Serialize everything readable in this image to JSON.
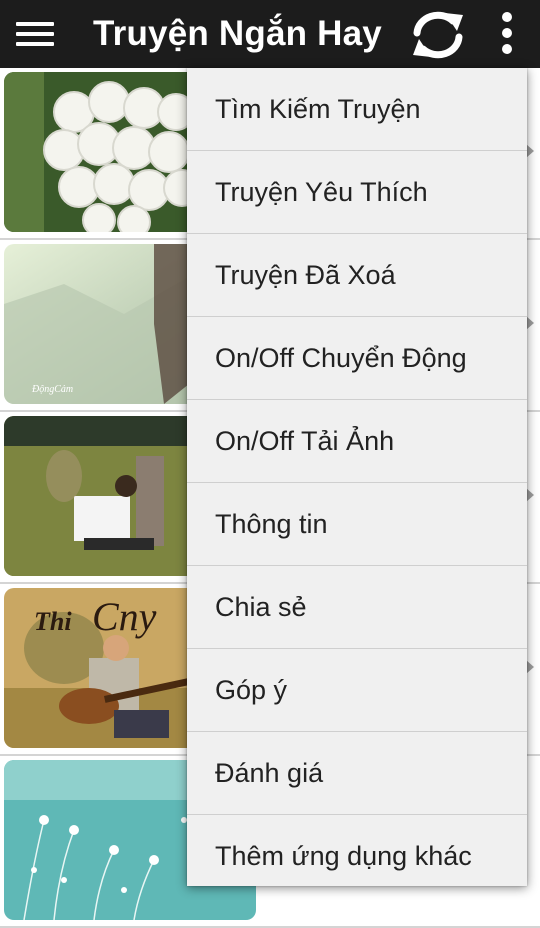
{
  "app": {
    "title": "Truyện Ngắn Hay",
    "icons": {
      "menu": "hamburger-menu-icon",
      "refresh": "refresh-icon",
      "overflow": "overflow-menu-icon"
    },
    "colors": {
      "action_bar": "#1c1c1c",
      "menu_background": "#f0f0f0",
      "menu_text": "#222222"
    }
  },
  "story_list": {
    "items": [
      {
        "thumbnail": "white-roses-image"
      },
      {
        "thumbnail": "misty-trees-girl-image"
      },
      {
        "thumbnail": "man-at-grave-image"
      },
      {
        "thumbnail": "guitar-player-image"
      },
      {
        "thumbnail": "teal-dandelion-image"
      }
    ]
  },
  "overflow_menu": {
    "items": [
      {
        "label": "Tìm Kiếm Truyện"
      },
      {
        "label": "Truyện Yêu Thích"
      },
      {
        "label": "Truyện Đã Xoá"
      },
      {
        "label": "On/Off Chuyển Động"
      },
      {
        "label": "On/Off Tải Ảnh"
      },
      {
        "label": "Thông tin"
      },
      {
        "label": "Chia sẻ"
      },
      {
        "label": "Góp ý"
      },
      {
        "label": "Đánh giá"
      },
      {
        "label": "Thêm ứng dụng khác"
      }
    ]
  }
}
